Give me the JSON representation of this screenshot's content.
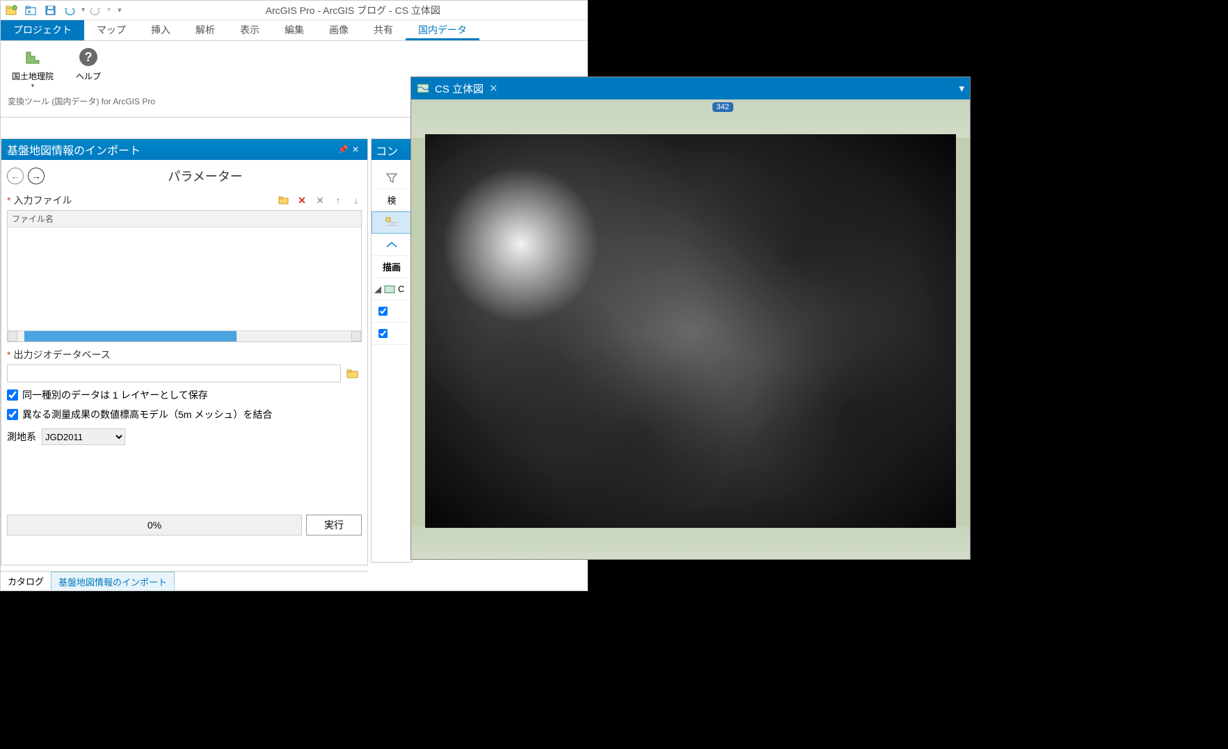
{
  "window": {
    "title": "ArcGIS Pro - ArcGIS ブログ - CS 立体図"
  },
  "qat": {
    "dropdown": "▾"
  },
  "ribbon": {
    "tabs": {
      "file": "プロジェクト",
      "map": "マップ",
      "insert": "挿入",
      "analysis": "解析",
      "view": "表示",
      "edit": "編集",
      "imagery": "画像",
      "share": "共有",
      "domestic": "国内データ"
    },
    "buttons": {
      "gsi": "国土地理院",
      "help": "ヘルプ"
    },
    "group_label": "変換ツール (国内データ) for ArcGIS Pro"
  },
  "tool_panel": {
    "title": "基盤地図情報のインポート",
    "param_header": "パラメーター",
    "input_file_label": "入力ファイル",
    "filename_col": "ファイル名",
    "output_gdb_label": "出力ジオデータベース",
    "gdb_value": "",
    "chk_same_kind": "同一種別のデータは 1 レイヤーとして保存",
    "chk_merge_dem": "異なる測量成果の数値標高モデル（5m メッシュ）を結合",
    "datum_label": "測地系",
    "datum_value": "JGD2011",
    "progress": "0%",
    "run": "実行"
  },
  "bottom_tabs": {
    "catalog": "カタログ",
    "tool": "基盤地図情報のインポート"
  },
  "side_panel": {
    "title": "コン",
    "search": "検",
    "draw_label": "描画",
    "layer1": "C"
  },
  "map": {
    "tab_title": "CS 立体図",
    "route": "342"
  }
}
